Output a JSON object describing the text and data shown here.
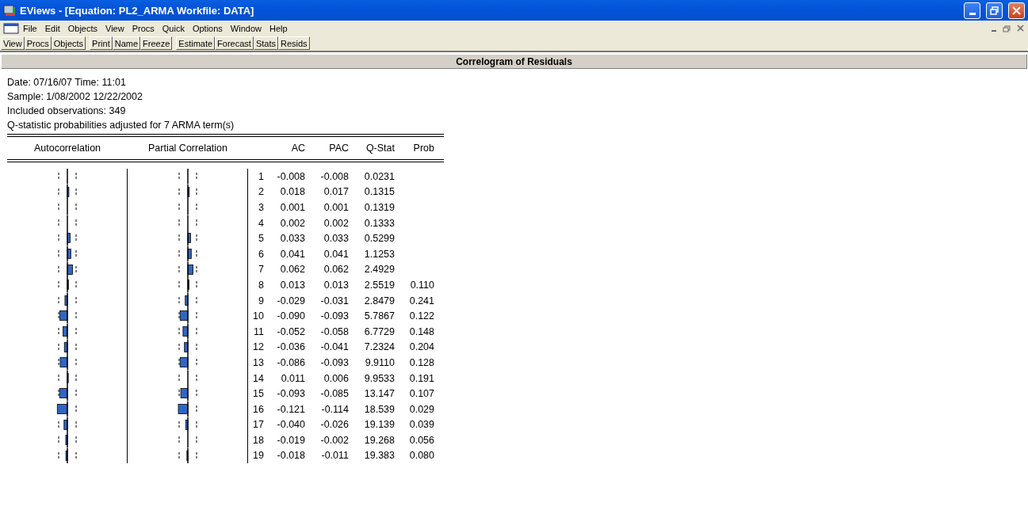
{
  "window": {
    "title": "EViews - [Equation: PL2_ARMA   Workfile: DATA]"
  },
  "menu": [
    "File",
    "Edit",
    "Objects",
    "View",
    "Procs",
    "Quick",
    "Options",
    "Window",
    "Help"
  ],
  "toolbar": [
    [
      "View",
      "Procs",
      "Objects"
    ],
    [
      "Print",
      "Name",
      "Freeze"
    ],
    [
      "Estimate",
      "Forecast",
      "Stats",
      "Resids"
    ]
  ],
  "view_title": "Correlogram of Residuals",
  "info": [
    "Date: 07/16/07   Time: 11:01",
    "Sample: 1/08/2002 12/22/2002",
    "Included observations: 349",
    "Q-statistic probabilities adjusted for 7 ARMA term(s)"
  ],
  "columns": [
    "Autocorrelation",
    "Partial Correlation",
    "AC",
    "PAC",
    "Q-Stat",
    "Prob"
  ],
  "rows": [
    {
      "lag": "1",
      "ac": "-0.008",
      "pac": "-0.008",
      "q": "0.0231"
    },
    {
      "lag": "2",
      "ac": "0.018",
      "pac": "0.017",
      "q": "0.1315"
    },
    {
      "lag": "3",
      "ac": "0.001",
      "pac": "0.001",
      "q": "0.1319"
    },
    {
      "lag": "4",
      "ac": "0.002",
      "pac": "0.002",
      "q": "0.1333"
    },
    {
      "lag": "5",
      "ac": "0.033",
      "pac": "0.033",
      "q": "0.5299"
    },
    {
      "lag": "6",
      "ac": "0.041",
      "pac": "0.041",
      "q": "1.1253"
    },
    {
      "lag": "7",
      "ac": "0.062",
      "pac": "0.062",
      "q": "2.4929"
    },
    {
      "lag": "8",
      "ac": "0.013",
      "pac": "0.013",
      "q": "2.5519",
      "prob": "0.110"
    },
    {
      "lag": "9",
      "ac": "-0.029",
      "pac": "-0.031",
      "q": "2.8479",
      "prob": "0.241"
    },
    {
      "lag": "10",
      "ac": "-0.090",
      "pac": "-0.093",
      "q": "5.7867",
      "prob": "0.122"
    },
    {
      "lag": "11",
      "ac": "-0.052",
      "pac": "-0.058",
      "q": "6.7729",
      "prob": "0.148"
    },
    {
      "lag": "12",
      "ac": "-0.036",
      "pac": "-0.041",
      "q": "7.2324",
      "prob": "0.204"
    },
    {
      "lag": "13",
      "ac": "-0.086",
      "pac": "-0.093",
      "q": "9.9110",
      "prob": "0.128"
    },
    {
      "lag": "14",
      "ac": "0.011",
      "pac": "0.006",
      "q": "9.9533",
      "prob": "0.191"
    },
    {
      "lag": "15",
      "ac": "-0.093",
      "pac": "-0.085",
      "q": "13.147",
      "prob": "0.107"
    },
    {
      "lag": "16",
      "ac": "-0.121",
      "pac": "-0.114",
      "q": "18.539",
      "prob": "0.029"
    },
    {
      "lag": "17",
      "ac": "-0.040",
      "pac": "-0.026",
      "q": "19.139",
      "prob": "0.039"
    },
    {
      "lag": "18",
      "ac": "-0.019",
      "pac": "-0.002",
      "q": "19.268",
      "prob": "0.056"
    },
    {
      "lag": "19",
      "ac": "-0.018",
      "pac": "-0.011",
      "q": "19.383",
      "prob": "0.080"
    }
  ]
}
